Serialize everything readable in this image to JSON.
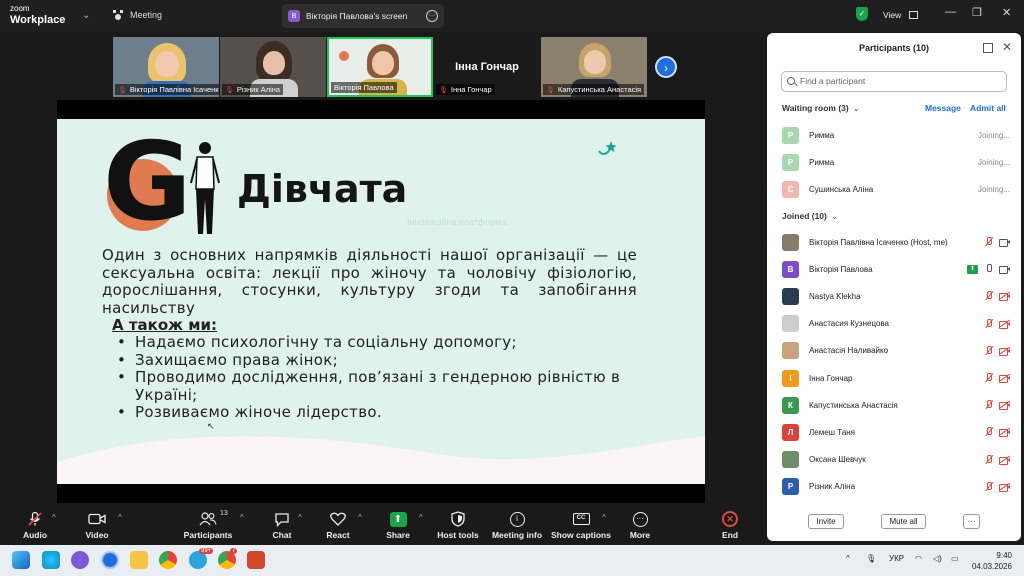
{
  "topbar": {
    "logo_line1": "zoom",
    "logo_line2": "Workplace",
    "meeting_label": "Meeting",
    "screen_label": "Вікторія Павлова's screen",
    "screen_avatar": "В",
    "view_label": "View"
  },
  "thumbnails": [
    {
      "name": "Вікторія Павлівна Ісаченко",
      "muted": true
    },
    {
      "name": "Різник  Аліна",
      "muted": true
    },
    {
      "name": "Вікторія Павлова",
      "muted": false
    },
    {
      "name": "Інна Гончар",
      "muted": true,
      "big_label": "Інна Гончар"
    },
    {
      "name": "Капустинська Анастасія",
      "muted": true
    }
  ],
  "slide": {
    "title": "Дівчата",
    "ghost_text": "Інноваційна платформа",
    "paragraph": "Один з основних напрямків діяльності нашої організації — це сексуальна освіта: лекції про жіночу та чоловічу фізіологію, дорослішання, стосунки, культуру згоди та запобігання насильству",
    "also_label": "А також ми:",
    "bullets": [
      "Надаємо психологічну та соціальну допомогу;",
      "Захищаємо права жінок;",
      "Проводимо дослідження, пов’язані з гендерною рівністю в Україні;",
      "Розвиваємо жіноче лідерство."
    ]
  },
  "participants": {
    "title": "Participants (10)",
    "search_placeholder": "Find a participant",
    "waiting_label": "Waiting room (3)",
    "message_label": "Message",
    "admit_all_label": "Admit all",
    "waiting": [
      {
        "initial": "Р",
        "name": "Римма",
        "status": "Joining...",
        "color": "#a9d7ae"
      },
      {
        "initial": "Р",
        "name": "Римма",
        "status": "Joining...",
        "color": "#a9d7ae"
      },
      {
        "initial": "С",
        "name": "Сушинська Аліна",
        "status": "Joining...",
        "color": "#f2b8b0"
      }
    ],
    "joined_label": "Joined (10)",
    "joined": [
      {
        "initial": "",
        "name": "Вікторія Павлівна Ісаченко (Host, me)",
        "color": "#8a7a6a"
      },
      {
        "initial": "В",
        "name": "Вікторія Павлова",
        "color": "#7e4bc9"
      },
      {
        "initial": "",
        "name": "Nastya Klekha",
        "color": "#2d3b52"
      },
      {
        "initial": "",
        "name": "Анастасия Кузнецова",
        "color": "#cccccc"
      },
      {
        "initial": "",
        "name": "Анастасія Наливайко",
        "color": "#c9a27e"
      },
      {
        "initial": "І",
        "name": "Інна Гончар",
        "color": "#f39a1e"
      },
      {
        "initial": "К",
        "name": "Капустинська Анастасія",
        "color": "#3a9a52"
      },
      {
        "initial": "Л",
        "name": "Лемеш Таня",
        "color": "#d9443a"
      },
      {
        "initial": "",
        "name": "Оксана Шевчук",
        "color": "#6b8f6a"
      },
      {
        "initial": "Р",
        "name": "Різник  Аліна",
        "color": "#2f5bb0"
      }
    ],
    "invite_label": "Invite",
    "mute_all_label": "Mute all",
    "more_label": "···"
  },
  "toolbar": {
    "audio": "Audio",
    "video": "Video",
    "participants": "Participants",
    "participants_count": "13",
    "chat": "Chat",
    "react": "React",
    "share": "Share",
    "host_tools": "Host tools",
    "meeting_info": "Meeting info",
    "captions": "Show captions",
    "more": "More",
    "end": "End"
  },
  "taskbar": {
    "lang": "УКР",
    "time": "9:40",
    "date": "04.03.2026",
    "badge": "99+",
    "badge2": "7"
  }
}
